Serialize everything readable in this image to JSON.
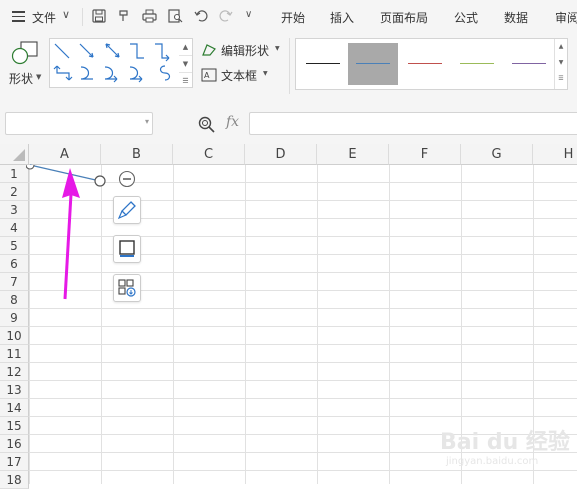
{
  "menu": {
    "file_label": "文件",
    "tabs": [
      "开始",
      "插入",
      "页面布局",
      "公式",
      "数据",
      "审阅"
    ]
  },
  "ribbon": {
    "shape_label": "形状",
    "edit_shape_label": "编辑形状",
    "textbox_label": "文本框",
    "line_styles": [
      {
        "color": "#222222",
        "selected": false
      },
      {
        "color": "#4a80b8",
        "selected": true
      },
      {
        "color": "#c0504d",
        "selected": false
      },
      {
        "color": "#9bbb59",
        "selected": false
      },
      {
        "color": "#8064a2",
        "selected": false
      }
    ]
  },
  "formula_bar": {
    "name_box_value": "",
    "fx_label": "fx",
    "formula_value": ""
  },
  "sheet": {
    "columns": [
      "A",
      "B",
      "C",
      "D",
      "E",
      "F",
      "G",
      "H"
    ],
    "rows": [
      "1",
      "2",
      "3",
      "4",
      "5",
      "6",
      "7",
      "8",
      "9",
      "10",
      "11",
      "12",
      "13",
      "14",
      "15",
      "16",
      "17",
      "18"
    ]
  },
  "accent_color": "#e619e6",
  "watermark": {
    "main": "Bai du 经验",
    "sub": "jingyan.baidu.com"
  }
}
